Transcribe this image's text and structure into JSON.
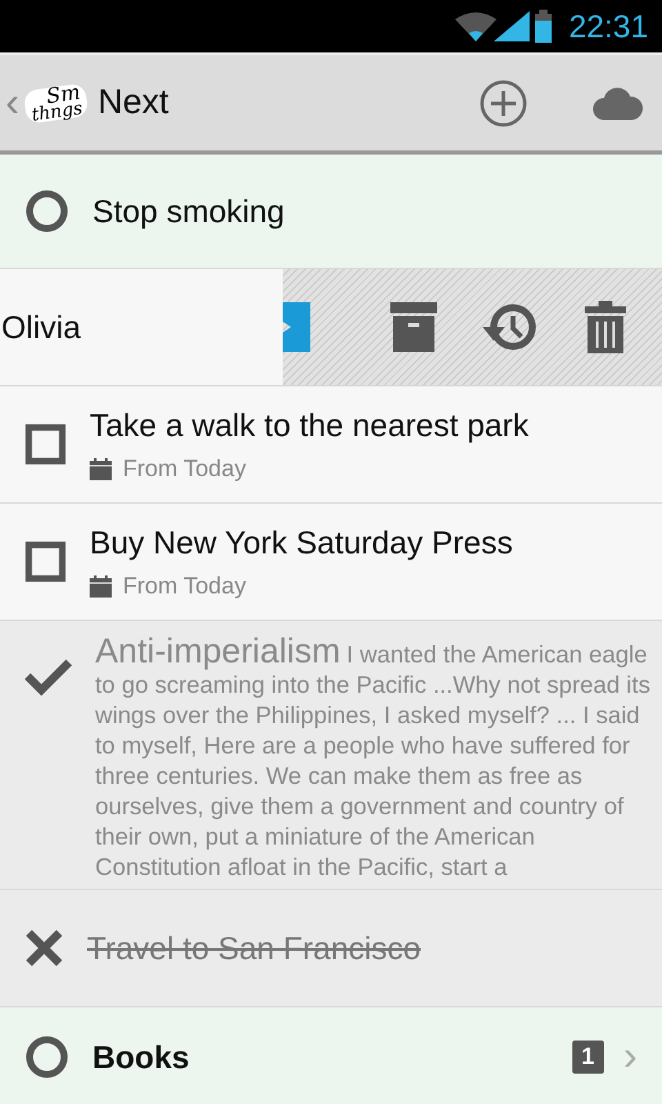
{
  "status_bar": {
    "time": "22:31"
  },
  "header": {
    "back": "‹",
    "logo": [
      "Sm",
      "thngs"
    ],
    "title": "Next"
  },
  "rows": [
    {
      "kind": "project",
      "title": "Stop smoking"
    },
    {
      "kind": "swiped",
      "title": "Olivia"
    },
    {
      "kind": "task",
      "completed": false,
      "title": "Take a walk to the nearest park",
      "date": "From Today"
    },
    {
      "kind": "task",
      "completed": false,
      "title": "Buy New York Saturday Press",
      "date": "From Today"
    },
    {
      "kind": "task",
      "completed": true,
      "title": "Anti-imperialism",
      "notes": "I wanted the American eagle to go screaming into the Pacific ...Why not spread its wings over the Philippines, I asked myself? ... I said to myself, Here are a people who have suffered for three centuries. We can make them as free as ourselves, give them a government and country of their own, put a miniature of the American Constitution afloat in the Pacific, start a"
    },
    {
      "kind": "task",
      "canceled": true,
      "title": "Travel to San Francisco"
    },
    {
      "kind": "area",
      "title": "Books",
      "count": "1",
      "chevron": "›"
    }
  ]
}
